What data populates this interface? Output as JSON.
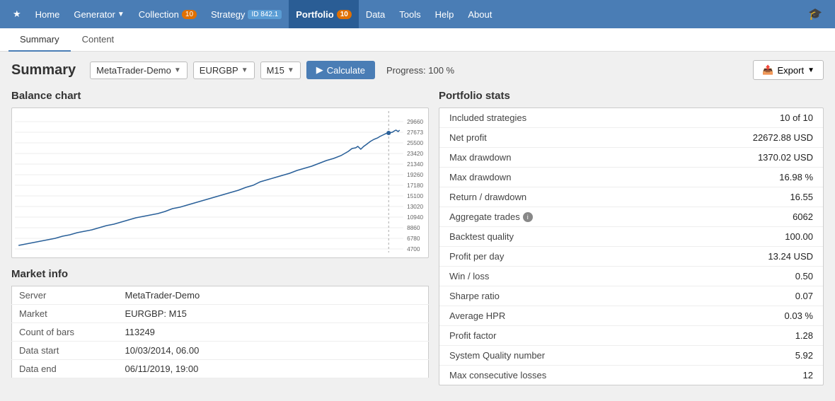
{
  "nav": {
    "items": [
      {
        "label": "Home",
        "id": "home",
        "active": false,
        "badge": null,
        "id_badge": null,
        "arrow": false
      },
      {
        "label": "Generator",
        "id": "generator",
        "active": false,
        "badge": null,
        "id_badge": null,
        "arrow": true
      },
      {
        "label": "Collection",
        "id": "collection",
        "active": false,
        "badge": "10",
        "id_badge": null,
        "arrow": false
      },
      {
        "label": "Strategy",
        "id": "strategy",
        "active": false,
        "badge": null,
        "id_badge": "ID 842.1",
        "arrow": false
      },
      {
        "label": "Portfolio",
        "id": "portfolio",
        "active": true,
        "badge": "10",
        "id_badge": null,
        "arrow": false
      },
      {
        "label": "Data",
        "id": "data",
        "active": false,
        "badge": null,
        "id_badge": null,
        "arrow": false
      },
      {
        "label": "Tools",
        "id": "tools",
        "active": false,
        "badge": null,
        "id_badge": null,
        "arrow": false
      },
      {
        "label": "Help",
        "id": "help",
        "active": false,
        "badge": null,
        "id_badge": null,
        "arrow": false
      },
      {
        "label": "About",
        "id": "about",
        "active": false,
        "badge": null,
        "id_badge": null,
        "arrow": false
      }
    ]
  },
  "tabs": [
    {
      "label": "Summary",
      "active": true
    },
    {
      "label": "Content",
      "active": false
    }
  ],
  "toolbar": {
    "title": "Summary",
    "server_dropdown": "MetaTrader-Demo",
    "pair_dropdown": "EURGBP",
    "tf_dropdown": "M15",
    "calc_label": "Calculate",
    "progress_label": "Progress: 100 %",
    "export_label": "Export"
  },
  "balance_chart": {
    "title": "Balance chart",
    "y_labels": [
      "29660",
      "27673",
      "25500",
      "23420",
      "21340",
      "19260",
      "17180",
      "15100",
      "13020",
      "10940",
      "8860",
      "6780",
      "4700"
    ],
    "data_points": [
      [
        0,
        185
      ],
      [
        10,
        183
      ],
      [
        20,
        178
      ],
      [
        35,
        175
      ],
      [
        50,
        172
      ],
      [
        65,
        168
      ],
      [
        80,
        162
      ],
      [
        95,
        158
      ],
      [
        110,
        154
      ],
      [
        125,
        150
      ],
      [
        140,
        145
      ],
      [
        155,
        140
      ],
      [
        170,
        136
      ],
      [
        185,
        130
      ],
      [
        200,
        125
      ],
      [
        215,
        120
      ],
      [
        230,
        113
      ],
      [
        245,
        108
      ],
      [
        260,
        104
      ],
      [
        275,
        100
      ],
      [
        290,
        95
      ],
      [
        305,
        90
      ],
      [
        320,
        85
      ],
      [
        335,
        80
      ],
      [
        350,
        74
      ],
      [
        365,
        70
      ],
      [
        380,
        65
      ],
      [
        395,
        62
      ],
      [
        410,
        58
      ],
      [
        425,
        54
      ],
      [
        440,
        50
      ],
      [
        455,
        46
      ],
      [
        470,
        43
      ],
      [
        485,
        40
      ],
      [
        500,
        37
      ],
      [
        510,
        35
      ],
      [
        520,
        30
      ],
      [
        525,
        28
      ]
    ]
  },
  "market_info": {
    "title": "Market info",
    "rows": [
      {
        "label": "Server",
        "value": "MetaTrader-Demo"
      },
      {
        "label": "Market",
        "value": "EURGBP: M15"
      },
      {
        "label": "Count of bars",
        "value": "113249"
      },
      {
        "label": "Data start",
        "value": "10/03/2014, 06.00"
      },
      {
        "label": "Data end",
        "value": "06/11/2019, 19:00"
      }
    ]
  },
  "portfolio_stats": {
    "title": "Portfolio stats",
    "rows": [
      {
        "label": "Included strategies",
        "value": "10 of 10",
        "has_info": false
      },
      {
        "label": "Net profit",
        "value": "22672.88 USD",
        "has_info": false
      },
      {
        "label": "Max drawdown",
        "value": "1370.02 USD",
        "has_info": false
      },
      {
        "label": "Max drawdown",
        "value": "16.98 %",
        "has_info": false
      },
      {
        "label": "Return / drawdown",
        "value": "16.55",
        "has_info": false
      },
      {
        "label": "Aggregate trades",
        "value": "6062",
        "has_info": true
      },
      {
        "label": "Backtest quality",
        "value": "100.00",
        "has_info": false
      },
      {
        "label": "Profit per day",
        "value": "13.24 USD",
        "has_info": false
      },
      {
        "label": "Win / loss",
        "value": "0.50",
        "has_info": false
      },
      {
        "label": "Sharpe ratio",
        "value": "0.07",
        "has_info": false
      },
      {
        "label": "Average HPR",
        "value": "0.03 %",
        "has_info": false
      },
      {
        "label": "Profit factor",
        "value": "1.28",
        "has_info": false
      },
      {
        "label": "System Quality number",
        "value": "5.92",
        "has_info": false
      },
      {
        "label": "Max consecutive losses",
        "value": "12",
        "has_info": false
      }
    ]
  },
  "colors": {
    "nav_bg": "#4a7db5",
    "nav_active": "#2a5d95",
    "calc_btn": "#4a7db5",
    "chart_line": "#2a6099",
    "chart_grid": "#ddd"
  }
}
